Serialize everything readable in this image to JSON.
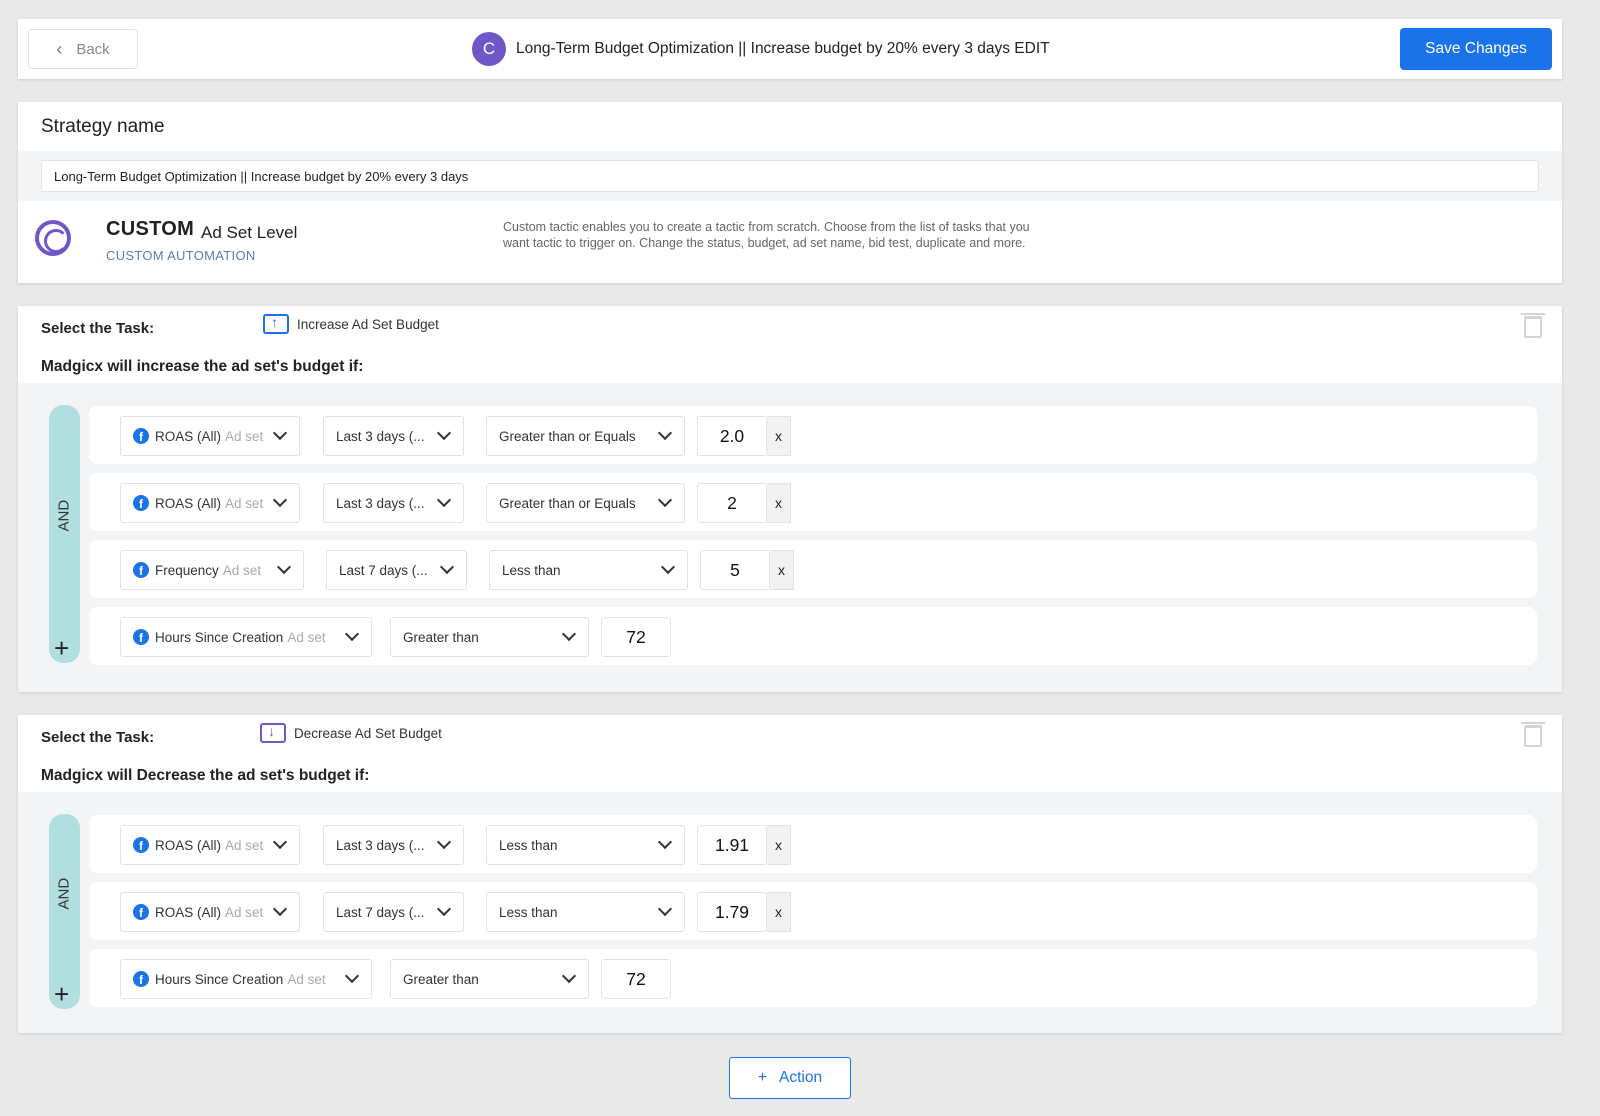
{
  "header": {
    "back_label": "Back",
    "avatar_letter": "C",
    "title": "Long-Term Budget Optimization || Increase budget by 20% every 3 days EDIT",
    "save_label": "Save Changes"
  },
  "strategy": {
    "label": "Strategy name",
    "name_value": "Long-Term Budget Optimization || Increase budget by 20% every 3 days",
    "type_title": "CUSTOM",
    "type_level": "Ad Set Level",
    "type_sub": "CUSTOM AUTOMATION",
    "description": "Custom tactic enables you to create a tactic from scratch. Choose from the list of tasks that you want tactic to trigger on. Change the status, budget, ad set name, bid test, duplicate and more."
  },
  "tasks": [
    {
      "label": "Select the Task:",
      "task_name": "Increase Ad Set Budget",
      "condition_heading": "Madgicx will increase the ad set's budget if:",
      "logic": "AND",
      "rows": [
        {
          "metric": "ROAS (All)",
          "level": "Ad set",
          "window": "Last 3 days (...",
          "operator": "Greater than or Equals",
          "value": "2.0",
          "remove": "x"
        },
        {
          "metric": "ROAS (All)",
          "level": "Ad set",
          "window": "Last 3 days (...",
          "operator": "Greater than or Equals",
          "value": "2",
          "remove": "x"
        },
        {
          "metric": "Frequency",
          "level": "Ad set",
          "window": "Last 7 days (...",
          "operator": "Less than",
          "value": "5",
          "remove": "x"
        },
        {
          "metric": "Hours Since Creation",
          "level": "Ad set",
          "operator": "Greater than",
          "value": "72"
        }
      ]
    },
    {
      "label": "Select the Task:",
      "task_name": "Decrease Ad Set Budget",
      "condition_heading": "Madgicx will Decrease the ad set's budget if:",
      "logic": "AND",
      "rows": [
        {
          "metric": "ROAS (All)",
          "level": "Ad set",
          "window": "Last 3 days (...",
          "operator": "Less than",
          "value": "1.91",
          "remove": "x"
        },
        {
          "metric": "ROAS (All)",
          "level": "Ad set",
          "window": "Last 7 days (...",
          "operator": "Less than",
          "value": "1.79",
          "remove": "x"
        },
        {
          "metric": "Hours Since Creation",
          "level": "Ad set",
          "operator": "Greater than",
          "value": "72"
        }
      ]
    }
  ],
  "footer": {
    "add_action_label": "Action",
    "add_action_icon": "+"
  },
  "colors": {
    "primary": "#1a73e8",
    "purple": "#7057c8",
    "and_bar": "#b1dfe0",
    "background": "#e9e9ea"
  }
}
